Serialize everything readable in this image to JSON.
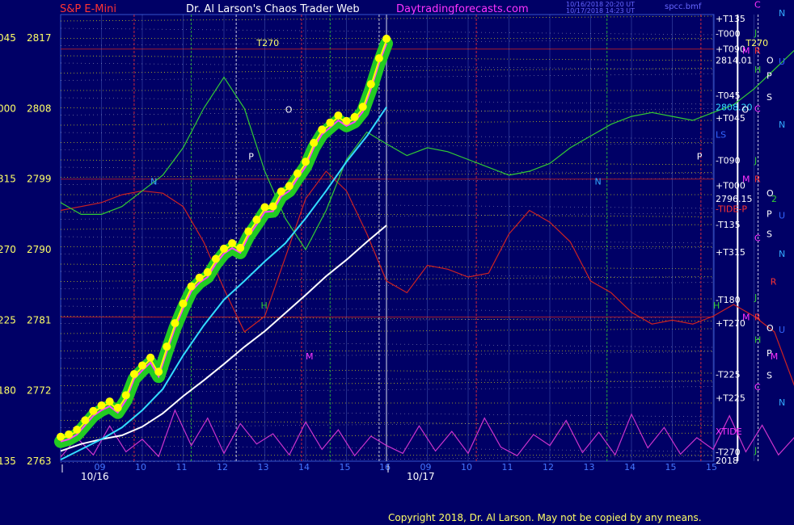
{
  "header": {
    "instrument": "S&P E-Mini",
    "site": "Dr. Al Larson's Chaos Trader Web",
    "url": "Daytradingforecasts.com",
    "timestamp_1": "10/16/2018 20:20 UT",
    "timestamp_2": "10/17/2018 14:23 UT",
    "file": "spcc.bmf"
  },
  "copyright": "Copyright 2018, Dr. Al Larson. May not be copied by any means.",
  "colors": {
    "background": "#000066",
    "title": "#ff3333",
    "site": "#ffffff",
    "url": "#ff33ff",
    "price_labels": "#ffff66",
    "grid": "#ffff00",
    "cyan": "#33ddff",
    "white": "#ffffff",
    "green": "#33cc33",
    "red": "#cc2222",
    "magenta": "#cc33cc"
  },
  "chart_data": {
    "type": "line",
    "y_ticks": [
      {
        "price": 2817,
        "angle": "045"
      },
      {
        "price": 2808,
        "angle": "000"
      },
      {
        "price": 2799,
        "angle": "315"
      },
      {
        "price": 2790,
        "angle": "270"
      },
      {
        "price": 2781,
        "angle": "225"
      },
      {
        "price": 2772,
        "angle": "180"
      },
      {
        "price": 2763,
        "angle": "135"
      }
    ],
    "ylim": [
      2763,
      2820
    ],
    "x_day_labels": [
      "10/16",
      "10/17"
    ],
    "x_hour_labels": [
      {
        "day": 0,
        "label": "09"
      },
      {
        "day": 0,
        "label": "10"
      },
      {
        "day": 0,
        "label": "11"
      },
      {
        "day": 0,
        "label": "12"
      },
      {
        "day": 0,
        "label": "13"
      },
      {
        "day": 0,
        "label": "14"
      },
      {
        "day": 0,
        "label": "15"
      },
      {
        "day": 0,
        "label": "16"
      },
      {
        "day": 1,
        "label": "09"
      },
      {
        "day": 1,
        "label": "10"
      },
      {
        "day": 1,
        "label": "11"
      },
      {
        "day": 1,
        "label": "12"
      },
      {
        "day": 1,
        "label": "13"
      },
      {
        "day": 1,
        "label": "14"
      },
      {
        "day": 1,
        "label": "15"
      },
      {
        "day": 1,
        "label": "15"
      }
    ],
    "right_flux_labels": [
      {
        "text": "+T135",
        "price": 2819.5,
        "color": "#ffffff"
      },
      {
        "text": "-T000",
        "price": 2817.6,
        "color": "#ffffff"
      },
      {
        "text": "+T090",
        "price": 2815.6,
        "color": "#ffffff"
      },
      {
        "text": "2814.01",
        "price": 2814.2,
        "color": "#ffffff"
      },
      {
        "text": "-T045",
        "price": 2809.7,
        "color": "#ffffff"
      },
      {
        "text": "2808.20",
        "price": 2808.2,
        "color": "#33ddff"
      },
      {
        "text": "+T045",
        "price": 2806.8,
        "color": "#ffffff"
      },
      {
        "text": "LS",
        "price": 2804.7,
        "color": "#3366ff"
      },
      {
        "text": "-T090",
        "price": 2801.4,
        "color": "#ffffff"
      },
      {
        "text": "+T000",
        "price": 2798.2,
        "color": "#ffffff"
      },
      {
        "text": "2796.15",
        "price": 2796.5,
        "color": "#ffffff"
      },
      {
        "text": "-TIDE-P",
        "price": 2795.2,
        "color": "#ff3333"
      },
      {
        "text": "-T135",
        "price": 2793.2,
        "color": "#ffffff"
      },
      {
        "text": "+T315",
        "price": 2789.7,
        "color": "#ffffff"
      },
      {
        "text": "-T180",
        "price": 2783.6,
        "color": "#ffffff"
      },
      {
        "text": "+T270",
        "price": 2780.6,
        "color": "#ffffff"
      },
      {
        "text": "-T225",
        "price": 2774.1,
        "color": "#ffffff"
      },
      {
        "text": "+T225",
        "price": 2771.1,
        "color": "#ffffff"
      },
      {
        "text": "XTIDE",
        "price": 2766.8,
        "color": "#ff33ff"
      },
      {
        "text": "-T270",
        "price": 2764.2,
        "color": "#ffffff"
      },
      {
        "text": "2018",
        "price": 2763.1,
        "color": "#ffffff"
      }
    ],
    "planet_labels": [
      {
        "text": "C",
        "price": 2821.3,
        "color": "#ff33ff",
        "col": 0
      },
      {
        "text": "N",
        "price": 2820.2,
        "color": "#33aaff",
        "col": 2
      },
      {
        "text": "J",
        "price": 2817.7,
        "color": "#33cc33",
        "col": 0
      },
      {
        "text": "M",
        "price": 2815.4,
        "color": "#ff33ff",
        "col": -1
      },
      {
        "text": "R",
        "price": 2815.4,
        "color": "#ff3333",
        "col": 0
      },
      {
        "text": "O",
        "price": 2814.2,
        "color": "#ffffff",
        "col": 1
      },
      {
        "text": "U",
        "price": 2814.0,
        "color": "#3366ff",
        "col": 2
      },
      {
        "text": "H",
        "price": 2813.0,
        "color": "#33cc33",
        "col": 0
      },
      {
        "text": "P",
        "price": 2812.2,
        "color": "#ffffff",
        "col": 1
      },
      {
        "text": "S",
        "price": 2809.5,
        "color": "#ffffff",
        "col": 1
      },
      {
        "text": "C",
        "price": 2808.0,
        "color": "#ff33ff",
        "col": 0
      },
      {
        "text": "N",
        "price": 2806.0,
        "color": "#33aaff",
        "col": 2
      },
      {
        "text": "J",
        "price": 2801.4,
        "color": "#33cc33",
        "col": 0
      },
      {
        "text": "M",
        "price": 2799.0,
        "color": "#ff33ff",
        "col": -1
      },
      {
        "text": "R",
        "price": 2799.0,
        "color": "#ff3333",
        "col": 0
      },
      {
        "text": "O",
        "price": 2797.2,
        "color": "#ffffff",
        "col": 1
      },
      {
        "text": "2",
        "price": 2796.5,
        "color": "#33cc33",
        "col": 1.4
      },
      {
        "text": "P",
        "price": 2794.6,
        "color": "#ffffff",
        "col": 1
      },
      {
        "text": "U",
        "price": 2794.4,
        "color": "#3366ff",
        "col": 2
      },
      {
        "text": "C",
        "price": 2791.5,
        "color": "#ff33ff",
        "col": 0
      },
      {
        "text": "S",
        "price": 2792.0,
        "color": "#ffffff",
        "col": 1
      },
      {
        "text": "N",
        "price": 2789.5,
        "color": "#33aaff",
        "col": 2
      },
      {
        "text": "J",
        "price": 2783.9,
        "color": "#33cc33",
        "col": 0
      },
      {
        "text": "M",
        "price": 2781.4,
        "color": "#ff33ff",
        "col": -1
      },
      {
        "text": "R",
        "price": 2781.4,
        "color": "#ff3333",
        "col": 0
      },
      {
        "text": "O",
        "price": 2780.0,
        "color": "#ffffff",
        "col": 1
      },
      {
        "text": "U",
        "price": 2779.8,
        "color": "#3366ff",
        "col": 2
      },
      {
        "text": "H",
        "price": 2778.5,
        "color": "#33cc33",
        "col": 0
      },
      {
        "text": "P",
        "price": 2776.8,
        "color": "#ffffff",
        "col": 1
      },
      {
        "text": "S",
        "price": 2774.0,
        "color": "#ffffff",
        "col": 1
      },
      {
        "text": "C",
        "price": 2772.5,
        "color": "#ff33ff",
        "col": 0
      },
      {
        "text": "N",
        "price": 2770.5,
        "color": "#33aaff",
        "col": 2
      },
      {
        "text": "J",
        "price": 2764.4,
        "color": "#33cc33",
        "col": 0
      }
    ],
    "in_chart_labels": [
      {
        "text": "T270",
        "hour": 4.8,
        "price": 2816.0,
        "color": "#ffff66"
      },
      {
        "text": "T270",
        "hour": 16.8,
        "price": 2816.0,
        "color": "#ffff66"
      },
      {
        "text": "O",
        "hour": 5.5,
        "price": 2807.5,
        "color": "#ffffff"
      },
      {
        "text": "O",
        "hour": 16.7,
        "price": 2807.5,
        "color": "#ffffff"
      },
      {
        "text": "P",
        "hour": 4.6,
        "price": 2801.5,
        "color": "#ffffff"
      },
      {
        "text": "P",
        "hour": 15.6,
        "price": 2801.5,
        "color": "#ffffff"
      },
      {
        "text": "N",
        "hour": 2.2,
        "price": 2798.3,
        "color": "#33aaff"
      },
      {
        "text": "N",
        "hour": 13.1,
        "price": 2798.3,
        "color": "#33aaff"
      },
      {
        "text": "H",
        "hour": 4.9,
        "price": 2782.5,
        "color": "#33cc33"
      },
      {
        "text": "H",
        "hour": 16.0,
        "price": 2782.5,
        "color": "#33cc33"
      },
      {
        "text": "R",
        "hour": 17.4,
        "price": 2785.5,
        "color": "#ff3333"
      },
      {
        "text": "M",
        "hour": 6.0,
        "price": 2776.0,
        "color": "#ff33ff"
      },
      {
        "text": "M",
        "hour": 17.4,
        "price": 2776.0,
        "color": "#ff33ff"
      }
    ],
    "series": [
      {
        "name": "price",
        "color": "#ffff00",
        "x": [
          0,
          0.2,
          0.4,
          0.6,
          0.8,
          1.0,
          1.2,
          1.4,
          1.6,
          1.8,
          2.0,
          2.2,
          2.4,
          2.6,
          2.8,
          3.0,
          3.2,
          3.4,
          3.6,
          3.8,
          4.0,
          4.2,
          4.4,
          4.6,
          4.8,
          5.0,
          5.2,
          5.4,
          5.6,
          5.8,
          6.0,
          6.2,
          6.4,
          6.6,
          6.8,
          7.0,
          7.2,
          7.4,
          7.6,
          7.8,
          8.0
        ],
        "y": [
          2765.5,
          2765.8,
          2766.4,
          2767.6,
          2768.8,
          2769.5,
          2770.0,
          2769.2,
          2770.8,
          2773.5,
          2774.6,
          2775.6,
          2773.8,
          2777.0,
          2780.0,
          2782.5,
          2784.7,
          2785.8,
          2786.5,
          2788.2,
          2789.5,
          2790.2,
          2789.6,
          2791.7,
          2793.2,
          2794.8,
          2794.9,
          2796.8,
          2797.5,
          2799.1,
          2800.6,
          2803.0,
          2804.7,
          2805.6,
          2806.5,
          2805.8,
          2806.3,
          2807.6,
          2810.5,
          2813.8,
          2816.3
        ]
      },
      {
        "name": "cyan",
        "color": "#33ddff",
        "x": [
          0,
          0.5,
          1.0,
          1.5,
          2.0,
          2.5,
          3.0,
          3.5,
          4.0,
          4.5,
          5.0,
          5.5,
          6.0,
          6.5,
          7.0,
          7.5,
          8.0
        ],
        "y": [
          2763.2,
          2764.5,
          2765.8,
          2767.3,
          2769.5,
          2772.2,
          2776.5,
          2780.3,
          2783.6,
          2786.0,
          2788.5,
          2790.8,
          2794.0,
          2797.5,
          2801.2,
          2804.5,
          2808.2
        ]
      },
      {
        "name": "white",
        "color": "#ffffff",
        "x": [
          0,
          0.5,
          1.0,
          1.5,
          2.0,
          2.5,
          3.0,
          3.5,
          4.0,
          4.5,
          5.0,
          5.5,
          6.0,
          6.5,
          7.0,
          7.5,
          8.0
        ],
        "y": [
          2764.3,
          2765.2,
          2765.8,
          2766.3,
          2767.4,
          2769.1,
          2771.3,
          2773.3,
          2775.4,
          2777.6,
          2779.6,
          2781.9,
          2784.2,
          2786.6,
          2788.7,
          2791.0,
          2793.1
        ]
      },
      {
        "name": "green",
        "color": "#33cc33",
        "x": [
          0,
          0.5,
          1.0,
          1.5,
          2.0,
          2.5,
          3.0,
          3.5,
          4.0,
          4.5,
          5.0,
          5.5,
          6.0,
          6.5,
          7.0,
          7.5,
          8.0,
          8.5,
          9.0,
          9.5,
          10.0,
          10.5,
          11.0,
          11.5,
          12.0,
          12.5,
          13.0,
          13.5,
          14.0,
          14.5,
          15.0,
          15.5,
          16.0,
          16.5,
          17.0,
          17.5,
          18.0,
          18.5,
          19.0,
          19.5,
          20.0
        ],
        "y": [
          2796.0,
          2794.5,
          2794.5,
          2795.5,
          2797.5,
          2799.5,
          2803.0,
          2808.0,
          2812.0,
          2808.0,
          2800.0,
          2794.0,
          2790.0,
          2795.0,
          2801.5,
          2805.0,
          2803.5,
          2802.0,
          2803.0,
          2802.5,
          2801.5,
          2800.5,
          2799.5,
          2800.0,
          2801.0,
          2803.0,
          2804.5,
          2806.0,
          2807.0,
          2807.5,
          2807.0,
          2806.5,
          2807.5,
          2808.5,
          2810.5,
          2813.0,
          2815.5,
          2813.0,
          2808.0,
          2801.0,
          2796.0
        ]
      },
      {
        "name": "red",
        "color": "#cc2222",
        "x": [
          0,
          0.5,
          1.0,
          1.5,
          2.0,
          2.5,
          3.0,
          3.5,
          4.0,
          4.5,
          5.0,
          5.5,
          6.0,
          6.5,
          7.0,
          7.5,
          8.0,
          8.5,
          9.0,
          9.5,
          10.0,
          10.5,
          11.0,
          11.5,
          12.0,
          12.5,
          13.0,
          13.5,
          14.0,
          14.5,
          15.0,
          15.5,
          16.0,
          16.5,
          17.0,
          17.5,
          18.0,
          18.5,
          19.0,
          19.5,
          20.0
        ],
        "y": [
          2795.0,
          2795.5,
          2796.0,
          2797.0,
          2797.5,
          2797.2,
          2795.5,
          2791.0,
          2785.0,
          2779.5,
          2781.5,
          2789.0,
          2796.5,
          2800.0,
          2797.5,
          2792.0,
          2786.0,
          2784.5,
          2788.0,
          2787.5,
          2786.5,
          2787.0,
          2792.0,
          2795.0,
          2793.5,
          2791.0,
          2786.0,
          2784.5,
          2782.0,
          2780.5,
          2781.0,
          2780.5,
          2781.5,
          2783.0,
          2781.5,
          2779.5,
          2772.5,
          2771.5,
          2776.0,
          2783.5,
          2792.0
        ]
      },
      {
        "name": "XTIDE",
        "color": "#cc33cc",
        "x": [
          0,
          0.4,
          0.8,
          1.2,
          1.6,
          2.0,
          2.4,
          2.8,
          3.2,
          3.6,
          4.0,
          4.4,
          4.8,
          5.2,
          5.6,
          6.0,
          6.4,
          6.8,
          7.2,
          7.6,
          8.0,
          8.4,
          8.8,
          9.2,
          9.6,
          10.0,
          10.4,
          10.8,
          11.2,
          11.6,
          12.0,
          12.4,
          12.8,
          13.2,
          13.6,
          14.0,
          14.4,
          14.8,
          15.2,
          15.6,
          16.0,
          16.4,
          16.8,
          17.2,
          17.6,
          18.0,
          18.4,
          18.8,
          19.2,
          19.6,
          20.0
        ],
        "y": [
          2763.5,
          2766.0,
          2763.8,
          2767.5,
          2764.2,
          2765.8,
          2763.6,
          2769.5,
          2765.0,
          2768.5,
          2764.0,
          2767.8,
          2765.2,
          2766.5,
          2763.8,
          2768.0,
          2764.5,
          2767.0,
          2763.7,
          2766.2,
          2765.0,
          2764.0,
          2767.5,
          2764.3,
          2766.8,
          2764.0,
          2768.5,
          2764.8,
          2763.7,
          2766.4,
          2765.0,
          2768.2,
          2764.1,
          2766.7,
          2763.8,
          2769.0,
          2764.7,
          2767.3,
          2763.9,
          2766.0,
          2764.5,
          2768.8,
          2764.2,
          2767.6,
          2763.8,
          2766.1,
          2765.0,
          2767.9,
          2764.0,
          2766.5,
          2765.5
        ]
      }
    ]
  }
}
